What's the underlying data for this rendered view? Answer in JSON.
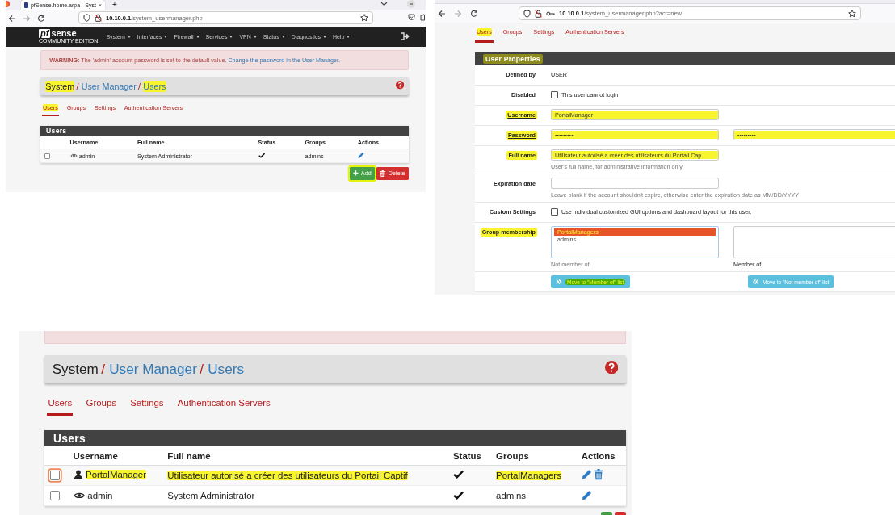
{
  "screenshots": [
    {
      "kind": "list",
      "browser": {
        "tab_title": "pfSense.home.arpa - Syst",
        "tab_close": "×",
        "new_tab": "+",
        "url_host": "10.10.0.1",
        "url_path": "/system_usermanager.php"
      },
      "navbar": {
        "logo_main": "pf",
        "logo_rest": "sense",
        "logo_sub": "COMMUNITY EDITION",
        "menu": [
          "System",
          "Interfaces",
          "Firewall",
          "Services",
          "VPN",
          "Status",
          "Diagnostics",
          "Help"
        ]
      },
      "warning": {
        "label": "WARNING:",
        "text": "The 'admin' account password is set to the default value.",
        "link": "Change the password in the User Manager."
      },
      "breadcrumb": {
        "separator": "/",
        "items": [
          {
            "text": "System",
            "highlighted": true
          },
          {
            "text": "User Manager",
            "highlighted": false
          },
          {
            "text": "Users",
            "highlighted": true
          }
        ]
      },
      "tabs": [
        {
          "label": "Users",
          "selected": true,
          "highlighted": true
        },
        {
          "label": "Groups",
          "selected": false,
          "highlighted": false
        },
        {
          "label": "Settings",
          "selected": false,
          "highlighted": false
        },
        {
          "label": "Authentication Servers",
          "selected": false,
          "highlighted": false
        }
      ],
      "table": {
        "title": "Users",
        "columns": [
          "Username",
          "Full name",
          "Status",
          "Groups",
          "Actions"
        ],
        "rows": [
          {
            "kind": "system",
            "checked": false,
            "focused": false,
            "highlighted": false,
            "username": "admin",
            "full_name": "System Administrator",
            "enabled": true,
            "groups": "admins",
            "deletable": false
          }
        ]
      },
      "buttons": [
        {
          "kind": "add",
          "label": "Add",
          "highlighted": true
        },
        {
          "kind": "delete",
          "label": "Delete",
          "highlighted": false
        }
      ]
    },
    {
      "kind": "form",
      "browser": {
        "url_host": "10.10.0.1",
        "url_path": "/system_usermanager.php?act=new"
      },
      "tabs": [
        {
          "label": "Users",
          "selected": true,
          "highlighted": true
        },
        {
          "label": "Groups",
          "selected": false,
          "highlighted": false
        },
        {
          "label": "Settings",
          "selected": false,
          "highlighted": false
        },
        {
          "label": "Authentication Servers",
          "selected": false,
          "highlighted": false
        }
      ],
      "section": {
        "title": "User Properties",
        "highlighted": true
      },
      "rows": [
        {
          "kind": "static",
          "label": "Defined by",
          "value": "USER",
          "highlighted": false,
          "required": false
        },
        {
          "kind": "checkbox",
          "label": "Disabled",
          "text": "This user cannot login",
          "checked": false,
          "highlighted": false,
          "required": false
        },
        {
          "kind": "input",
          "label": "Username",
          "value": "PortalManager",
          "highlighted": true,
          "required": true
        },
        {
          "kind": "password",
          "label": "Password",
          "value": "•••••••••",
          "confirm": "•••••••••",
          "highlighted": true,
          "required": true
        },
        {
          "kind": "input",
          "label": "Full name",
          "value": "Utilisateur autorisé a créer des utilisateurs du Portail Cap",
          "help": "User's full name, for administrative information only",
          "highlighted": true,
          "required": false
        },
        {
          "kind": "input",
          "label": "Expiration date",
          "help": "Leave blank if the account shouldn't expire, otherwise enter the expiration date as MM/DD/YYYY",
          "highlighted": false,
          "required": false
        },
        {
          "kind": "checkbox",
          "label": "Custom Settings",
          "text": "Use individual customized GUI options and dashboard layout for this user.",
          "checked": false,
          "highlighted": false,
          "required": false
        },
        {
          "kind": "groups",
          "label": "Group membership",
          "highlighted": true,
          "required": false,
          "options": [
            {
              "text": "PortalManagers",
              "selected": true
            },
            {
              "text": "admins",
              "selected": false
            }
          ],
          "left_caption": "Not member of",
          "right_caption": "Member of"
        },
        {
          "kind": "buttons",
          "buttons": [
            {
              "kind": "right",
              "label": "Move to \"Member of\" list",
              "highlighted": true
            },
            {
              "kind": "left",
              "label": "Move to \"Not member of\" list",
              "highlighted": false
            }
          ]
        }
      ]
    },
    {
      "kind": "list",
      "warning_cut": true,
      "breadcrumb": {
        "separator": "/",
        "items": [
          {
            "text": "System",
            "highlighted": false
          },
          {
            "text": "User Manager",
            "highlighted": false
          },
          {
            "text": "Users",
            "highlighted": false
          }
        ]
      },
      "tabs": [
        {
          "label": "Users",
          "selected": true,
          "highlighted": false
        },
        {
          "label": "Groups",
          "selected": false,
          "highlighted": false
        },
        {
          "label": "Settings",
          "selected": false,
          "highlighted": false
        },
        {
          "label": "Authentication Servers",
          "selected": false,
          "highlighted": false
        }
      ],
      "table": {
        "title": "Users",
        "columns": [
          "Username",
          "Full name",
          "Status",
          "Groups",
          "Actions"
        ],
        "rows": [
          {
            "kind": "user",
            "checked": false,
            "focused": true,
            "highlighted": true,
            "username": "PortalManager",
            "full_name": "Utilisateur autorisé a créer des utilisateurs du Portail Captif",
            "enabled": true,
            "groups": "PortalManagers",
            "deletable": true
          },
          {
            "kind": "system",
            "checked": false,
            "focused": false,
            "highlighted": false,
            "username": "admin",
            "full_name": "System Administrator",
            "enabled": true,
            "groups": "admins",
            "deletable": false
          }
        ]
      },
      "buttons": [
        {
          "kind": "add"
        },
        {
          "kind": "delete"
        }
      ]
    }
  ]
}
